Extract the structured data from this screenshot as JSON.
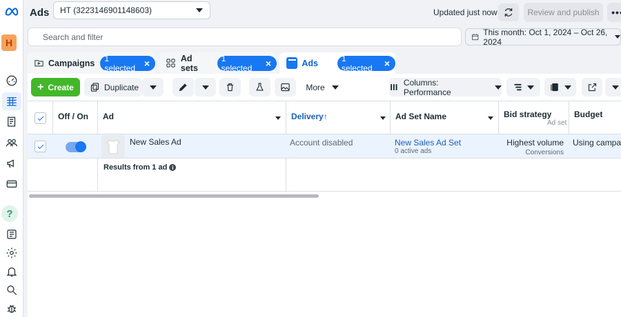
{
  "header": {
    "app_title": "Ads",
    "account": "HT (3223146901148603)",
    "updated": "Updated just now",
    "review_publish": "Review and publish",
    "more": "•••"
  },
  "rail": {
    "avatar_letter": "H",
    "help": "?"
  },
  "search": {
    "placeholder": "Search and filter"
  },
  "date_range": {
    "label": "This month: Oct 1, 2024 – Oct 26, 2024"
  },
  "tabs": [
    {
      "label": "Campaigns",
      "selected": "1 selected"
    },
    {
      "label": "Ad sets",
      "selected": "1 selected"
    },
    {
      "label": "Ads",
      "selected": "1 selected"
    }
  ],
  "toolbar": {
    "create": "Create",
    "duplicate": "Duplicate",
    "more": "More",
    "columns": "Columns: Performance"
  },
  "table": {
    "headers": {
      "off_on": "Off / On",
      "ad": "Ad",
      "delivery": "Delivery",
      "delivery_sort": "↑",
      "ad_set_name": "Ad Set Name",
      "bid_strategy": "Bid strategy",
      "bid_strategy_sub": "Ad set",
      "budget": "Budget"
    },
    "row": {
      "ad_name": "New Sales Ad",
      "delivery": "Account disabled",
      "ad_set_name": "New Sales Ad Set",
      "ad_set_sub": "0 active ads",
      "bid_strategy": "Highest volume",
      "bid_strategy_sub": "Conversions",
      "budget": "Using campaign"
    },
    "results": "Results from 1 ad"
  },
  "colors": {
    "accent": "#1877f2",
    "create": "#42b72a",
    "row_selected": "#ebf3ff"
  }
}
